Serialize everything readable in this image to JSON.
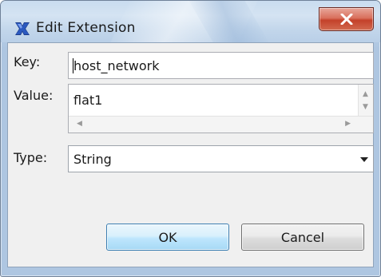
{
  "window": {
    "title": "Edit Extension",
    "app_icon": "eclipse-x-icon",
    "close_icon": "close-x-icon",
    "close_label": "X",
    "accent": "#c4412a"
  },
  "form": {
    "key": {
      "label": "Key:",
      "value": "host_network"
    },
    "value": {
      "label": "Value:",
      "value": "flat1"
    },
    "type": {
      "label": "Type:",
      "selected": "String"
    }
  },
  "buttons": {
    "ok_label": "OK",
    "cancel_label": "Cancel"
  }
}
